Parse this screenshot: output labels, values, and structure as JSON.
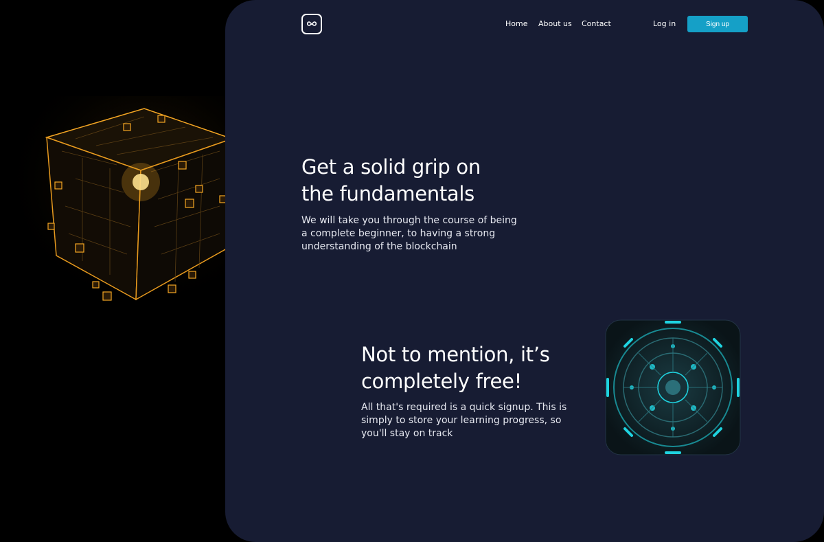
{
  "nav": {
    "logo_icon": "infinity-logo-icon",
    "links": [
      "Home",
      "About us",
      "Contact"
    ],
    "login": "Log in",
    "signup": "Sign up"
  },
  "section1": {
    "heading_line1": "Get a solid grip on",
    "heading_line2": "the fundamentals",
    "body_line1": "We will take you through the course of being",
    "body_line2": "a complete beginner, to having a strong",
    "body_line3": "understanding of the blockchain"
  },
  "section2": {
    "heading_line1": "Not to mention, it’s",
    "heading_line2": "completely free!",
    "body_line1": "All that's required is a quick signup. This is",
    "body_line2": "simply to store your learning progress, so",
    "body_line3": "you'll stay on track"
  },
  "images": {
    "cube": "glowing-blockchain-cube",
    "tile": "cyan-circuit-tile"
  },
  "colors": {
    "page": "#000000",
    "panel": "#171c33",
    "accent": "#15a0c7",
    "cube_glow": "#f5a623",
    "tile_glow": "#1fd3e0"
  }
}
